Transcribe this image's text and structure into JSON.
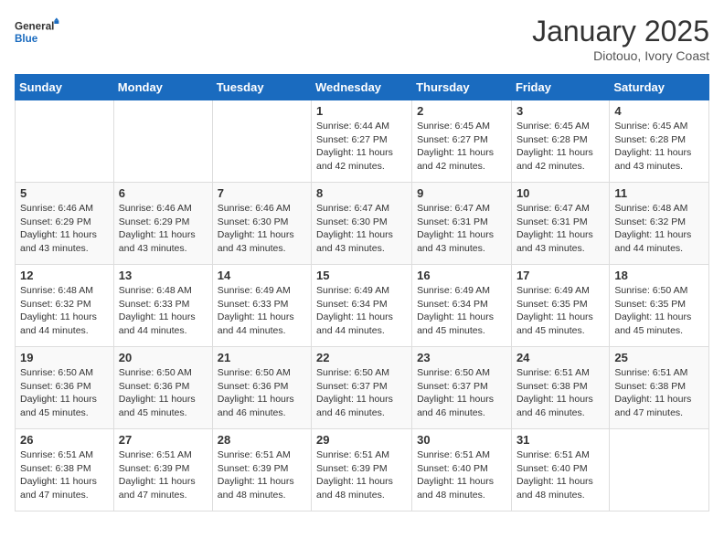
{
  "header": {
    "logo_general": "General",
    "logo_blue": "Blue",
    "month_title": "January 2025",
    "location": "Diotouo, Ivory Coast"
  },
  "weekdays": [
    "Sunday",
    "Monday",
    "Tuesday",
    "Wednesday",
    "Thursday",
    "Friday",
    "Saturday"
  ],
  "weeks": [
    [
      {
        "day": "",
        "info": ""
      },
      {
        "day": "",
        "info": ""
      },
      {
        "day": "",
        "info": ""
      },
      {
        "day": "1",
        "info": "Sunrise: 6:44 AM\nSunset: 6:27 PM\nDaylight: 11 hours and 42 minutes."
      },
      {
        "day": "2",
        "info": "Sunrise: 6:45 AM\nSunset: 6:27 PM\nDaylight: 11 hours and 42 minutes."
      },
      {
        "day": "3",
        "info": "Sunrise: 6:45 AM\nSunset: 6:28 PM\nDaylight: 11 hours and 42 minutes."
      },
      {
        "day": "4",
        "info": "Sunrise: 6:45 AM\nSunset: 6:28 PM\nDaylight: 11 hours and 43 minutes."
      }
    ],
    [
      {
        "day": "5",
        "info": "Sunrise: 6:46 AM\nSunset: 6:29 PM\nDaylight: 11 hours and 43 minutes."
      },
      {
        "day": "6",
        "info": "Sunrise: 6:46 AM\nSunset: 6:29 PM\nDaylight: 11 hours and 43 minutes."
      },
      {
        "day": "7",
        "info": "Sunrise: 6:46 AM\nSunset: 6:30 PM\nDaylight: 11 hours and 43 minutes."
      },
      {
        "day": "8",
        "info": "Sunrise: 6:47 AM\nSunset: 6:30 PM\nDaylight: 11 hours and 43 minutes."
      },
      {
        "day": "9",
        "info": "Sunrise: 6:47 AM\nSunset: 6:31 PM\nDaylight: 11 hours and 43 minutes."
      },
      {
        "day": "10",
        "info": "Sunrise: 6:47 AM\nSunset: 6:31 PM\nDaylight: 11 hours and 43 minutes."
      },
      {
        "day": "11",
        "info": "Sunrise: 6:48 AM\nSunset: 6:32 PM\nDaylight: 11 hours and 44 minutes."
      }
    ],
    [
      {
        "day": "12",
        "info": "Sunrise: 6:48 AM\nSunset: 6:32 PM\nDaylight: 11 hours and 44 minutes."
      },
      {
        "day": "13",
        "info": "Sunrise: 6:48 AM\nSunset: 6:33 PM\nDaylight: 11 hours and 44 minutes."
      },
      {
        "day": "14",
        "info": "Sunrise: 6:49 AM\nSunset: 6:33 PM\nDaylight: 11 hours and 44 minutes."
      },
      {
        "day": "15",
        "info": "Sunrise: 6:49 AM\nSunset: 6:34 PM\nDaylight: 11 hours and 44 minutes."
      },
      {
        "day": "16",
        "info": "Sunrise: 6:49 AM\nSunset: 6:34 PM\nDaylight: 11 hours and 45 minutes."
      },
      {
        "day": "17",
        "info": "Sunrise: 6:49 AM\nSunset: 6:35 PM\nDaylight: 11 hours and 45 minutes."
      },
      {
        "day": "18",
        "info": "Sunrise: 6:50 AM\nSunset: 6:35 PM\nDaylight: 11 hours and 45 minutes."
      }
    ],
    [
      {
        "day": "19",
        "info": "Sunrise: 6:50 AM\nSunset: 6:36 PM\nDaylight: 11 hours and 45 minutes."
      },
      {
        "day": "20",
        "info": "Sunrise: 6:50 AM\nSunset: 6:36 PM\nDaylight: 11 hours and 45 minutes."
      },
      {
        "day": "21",
        "info": "Sunrise: 6:50 AM\nSunset: 6:36 PM\nDaylight: 11 hours and 46 minutes."
      },
      {
        "day": "22",
        "info": "Sunrise: 6:50 AM\nSunset: 6:37 PM\nDaylight: 11 hours and 46 minutes."
      },
      {
        "day": "23",
        "info": "Sunrise: 6:50 AM\nSunset: 6:37 PM\nDaylight: 11 hours and 46 minutes."
      },
      {
        "day": "24",
        "info": "Sunrise: 6:51 AM\nSunset: 6:38 PM\nDaylight: 11 hours and 46 minutes."
      },
      {
        "day": "25",
        "info": "Sunrise: 6:51 AM\nSunset: 6:38 PM\nDaylight: 11 hours and 47 minutes."
      }
    ],
    [
      {
        "day": "26",
        "info": "Sunrise: 6:51 AM\nSunset: 6:38 PM\nDaylight: 11 hours and 47 minutes."
      },
      {
        "day": "27",
        "info": "Sunrise: 6:51 AM\nSunset: 6:39 PM\nDaylight: 11 hours and 47 minutes."
      },
      {
        "day": "28",
        "info": "Sunrise: 6:51 AM\nSunset: 6:39 PM\nDaylight: 11 hours and 48 minutes."
      },
      {
        "day": "29",
        "info": "Sunrise: 6:51 AM\nSunset: 6:39 PM\nDaylight: 11 hours and 48 minutes."
      },
      {
        "day": "30",
        "info": "Sunrise: 6:51 AM\nSunset: 6:40 PM\nDaylight: 11 hours and 48 minutes."
      },
      {
        "day": "31",
        "info": "Sunrise: 6:51 AM\nSunset: 6:40 PM\nDaylight: 11 hours and 48 minutes."
      },
      {
        "day": "",
        "info": ""
      }
    ]
  ]
}
